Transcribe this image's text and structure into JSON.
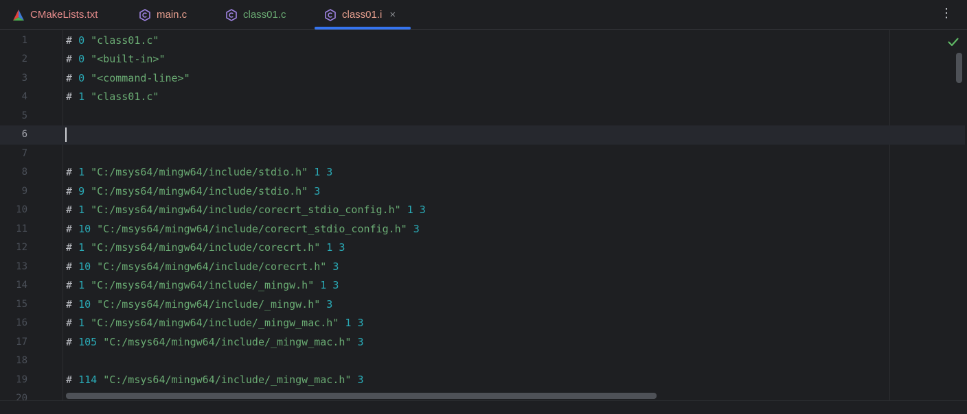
{
  "tabs": [
    {
      "label": "CMakeLists.txt",
      "icon": "cmake-triangle-icon",
      "color": "#e88d8d"
    },
    {
      "label": "main.c",
      "icon": "c-file-icon",
      "color": "#e8a08f"
    },
    {
      "label": "class01.c",
      "icon": "c-file-icon",
      "color": "#6aab73"
    },
    {
      "label": "class01.i",
      "icon": "c-file-icon",
      "color": "#e8a08f",
      "active": true,
      "close": "×"
    }
  ],
  "more_label": "⋮",
  "editor": {
    "current_line": 6,
    "lines": [
      {
        "n": "1",
        "hash": "#",
        "num": "0",
        "str": "\"class01.c\"",
        "flags": ""
      },
      {
        "n": "2",
        "hash": "#",
        "num": "0",
        "str": "\"<built-in>\"",
        "flags": ""
      },
      {
        "n": "3",
        "hash": "#",
        "num": "0",
        "str": "\"<command-line>\"",
        "flags": ""
      },
      {
        "n": "4",
        "hash": "#",
        "num": "1",
        "str": "\"class01.c\"",
        "flags": ""
      },
      {
        "n": "5",
        "hash": "",
        "num": "",
        "str": "",
        "flags": ""
      },
      {
        "n": "6",
        "hash": "",
        "num": "",
        "str": "",
        "flags": ""
      },
      {
        "n": "7",
        "hash": "",
        "num": "",
        "str": "",
        "flags": ""
      },
      {
        "n": "8",
        "hash": "#",
        "num": "1",
        "str": "\"C:/msys64/mingw64/include/stdio.h\"",
        "flags": "1 3"
      },
      {
        "n": "9",
        "hash": "#",
        "num": "9",
        "str": "\"C:/msys64/mingw64/include/stdio.h\"",
        "flags": "3"
      },
      {
        "n": "10",
        "hash": "#",
        "num": "1",
        "str": "\"C:/msys64/mingw64/include/corecrt_stdio_config.h\"",
        "flags": "1 3"
      },
      {
        "n": "11",
        "hash": "#",
        "num": "10",
        "str": "\"C:/msys64/mingw64/include/corecrt_stdio_config.h\"",
        "flags": "3"
      },
      {
        "n": "12",
        "hash": "#",
        "num": "1",
        "str": "\"C:/msys64/mingw64/include/corecrt.h\"",
        "flags": "1 3"
      },
      {
        "n": "13",
        "hash": "#",
        "num": "10",
        "str": "\"C:/msys64/mingw64/include/corecrt.h\"",
        "flags": "3"
      },
      {
        "n": "14",
        "hash": "#",
        "num": "1",
        "str": "\"C:/msys64/mingw64/include/_mingw.h\"",
        "flags": "1 3"
      },
      {
        "n": "15",
        "hash": "#",
        "num": "10",
        "str": "\"C:/msys64/mingw64/include/_mingw.h\"",
        "flags": "3"
      },
      {
        "n": "16",
        "hash": "#",
        "num": "1",
        "str": "\"C:/msys64/mingw64/include/_mingw_mac.h\"",
        "flags": "1 3"
      },
      {
        "n": "17",
        "hash": "#",
        "num": "105",
        "str": "\"C:/msys64/mingw64/include/_mingw_mac.h\"",
        "flags": "3"
      },
      {
        "n": "18",
        "hash": "",
        "num": "",
        "str": "",
        "flags": ""
      },
      {
        "n": "19",
        "hash": "#",
        "num": "114",
        "str": "\"C:/msys64/mingw64/include/_mingw_mac.h\"",
        "flags": "3"
      },
      {
        "n": "20",
        "hash": "",
        "num": "",
        "str": "",
        "flags": ""
      }
    ]
  },
  "status_icon": "checkmark-icon",
  "colors": {
    "background": "#1e1f22",
    "accent": "#3574f0",
    "number": "#2aacb8",
    "string": "#6aab73",
    "check": "#5fb865"
  }
}
